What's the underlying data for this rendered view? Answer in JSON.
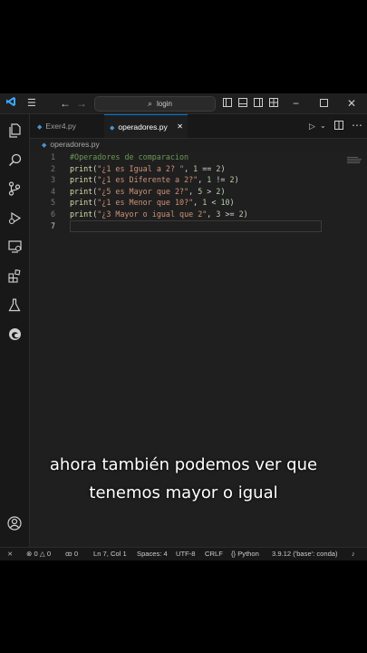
{
  "titlebar": {
    "search_text": "login"
  },
  "tabs": [
    {
      "label": "Exer4.py"
    },
    {
      "label": "operadores.py",
      "close": "✕"
    }
  ],
  "breadcrumb": "operadores.py",
  "editor": {
    "current_line": 7,
    "lines": [
      {
        "num": "1",
        "tokens": [
          {
            "t": "#Operadores de comparacion",
            "c": "cm"
          }
        ]
      },
      {
        "num": "2",
        "tokens": [
          {
            "t": "print",
            "c": "fn"
          },
          {
            "t": "(",
            "c": "op"
          },
          {
            "t": "\"¿1 es Igual a 2? \"",
            "c": "str"
          },
          {
            "t": ", ",
            "c": "op"
          },
          {
            "t": "1",
            "c": "num"
          },
          {
            "t": " == ",
            "c": "op"
          },
          {
            "t": "2",
            "c": "num"
          },
          {
            "t": ")",
            "c": "op"
          }
        ]
      },
      {
        "num": "3",
        "tokens": [
          {
            "t": "print",
            "c": "fn"
          },
          {
            "t": "(",
            "c": "op"
          },
          {
            "t": "\"¿1 es Diferente a 2?\"",
            "c": "str"
          },
          {
            "t": ", ",
            "c": "op"
          },
          {
            "t": "1",
            "c": "num"
          },
          {
            "t": " != ",
            "c": "op"
          },
          {
            "t": "2",
            "c": "num"
          },
          {
            "t": ")",
            "c": "op"
          }
        ]
      },
      {
        "num": "4",
        "tokens": [
          {
            "t": "print",
            "c": "fn"
          },
          {
            "t": "(",
            "c": "op"
          },
          {
            "t": "\"¿5 es Mayor que 2?\"",
            "c": "str"
          },
          {
            "t": ", ",
            "c": "op"
          },
          {
            "t": "5",
            "c": "num"
          },
          {
            "t": " > ",
            "c": "op"
          },
          {
            "t": "2",
            "c": "num"
          },
          {
            "t": ")",
            "c": "op"
          }
        ]
      },
      {
        "num": "5",
        "tokens": [
          {
            "t": "print",
            "c": "fn"
          },
          {
            "t": "(",
            "c": "op"
          },
          {
            "t": "\"¿1 es Menor que 10?\"",
            "c": "str"
          },
          {
            "t": ", ",
            "c": "op"
          },
          {
            "t": "1",
            "c": "num"
          },
          {
            "t": " < ",
            "c": "op"
          },
          {
            "t": "10",
            "c": "num"
          },
          {
            "t": ")",
            "c": "op"
          }
        ]
      },
      {
        "num": "6",
        "tokens": [
          {
            "t": "print",
            "c": "fn"
          },
          {
            "t": "(",
            "c": "op"
          },
          {
            "t": "\"¿3 Mayor o igual que 2\"",
            "c": "str"
          },
          {
            "t": ", ",
            "c": "op"
          },
          {
            "t": "3",
            "c": "num"
          },
          {
            "t": " >= ",
            "c": "op"
          },
          {
            "t": "2",
            "c": "num"
          },
          {
            "t": ")",
            "c": "op"
          }
        ]
      },
      {
        "num": "7",
        "tokens": []
      }
    ]
  },
  "statusbar": {
    "errors": "0",
    "warnings": "0",
    "ports": "0",
    "position": "Ln 7, Col 1",
    "spaces": "Spaces: 4",
    "encoding": "UTF-8",
    "eol": "CRLF",
    "language": "Python",
    "interpreter": "3.9.12 ('base': conda)"
  },
  "caption": {
    "line1": "ahora también podemos ver que",
    "line2": "tenemos mayor o igual"
  },
  "colors": {
    "accent": "#0078d4",
    "editor_bg": "#1f1f1f",
    "string": "#ce9178",
    "function": "#dcdcaa",
    "number": "#b5cea8",
    "comment": "#6a9955"
  }
}
